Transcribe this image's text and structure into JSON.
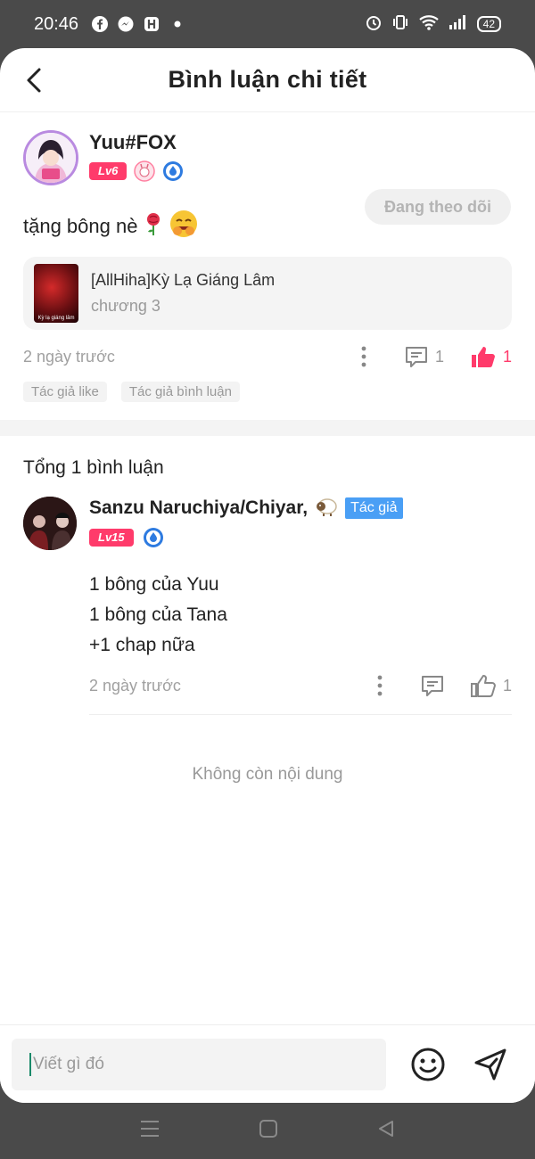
{
  "status_bar": {
    "time": "20:46",
    "battery": "42"
  },
  "header": {
    "title": "Bình luận chi tiết"
  },
  "post": {
    "username": "Yuu#FOX",
    "level": "Lv6",
    "follow_label": "Đang theo dõi",
    "text": "tặng bông nè",
    "story": {
      "cover_caption": "Kỳ lạ giáng lâm",
      "title": "[AllHiha]Kỳ Lạ Giáng Lâm",
      "chapter": "chương 3"
    },
    "time": "2 ngày trước",
    "reply_count": "1",
    "like_count": "1",
    "tags": [
      "Tác giả like",
      "Tác giả bình luận"
    ]
  },
  "comments": {
    "total_label": "Tổng 1 bình luận",
    "items": [
      {
        "name": "Sanzu Naruchiya/Chiyar,",
        "author_tag": "Tác giả",
        "level": "Lv15",
        "lines": [
          "1 bông của Yuu",
          "1 bông của Tana",
          "+1 chap nữa"
        ],
        "time": "2 ngày trước",
        "like_count": "1"
      }
    ],
    "end_label": "Không còn nội dung"
  },
  "input": {
    "placeholder": "Viết gì đó"
  },
  "colors": {
    "accent": "#ff3b6b",
    "author_tag": "#4a9ff5"
  }
}
